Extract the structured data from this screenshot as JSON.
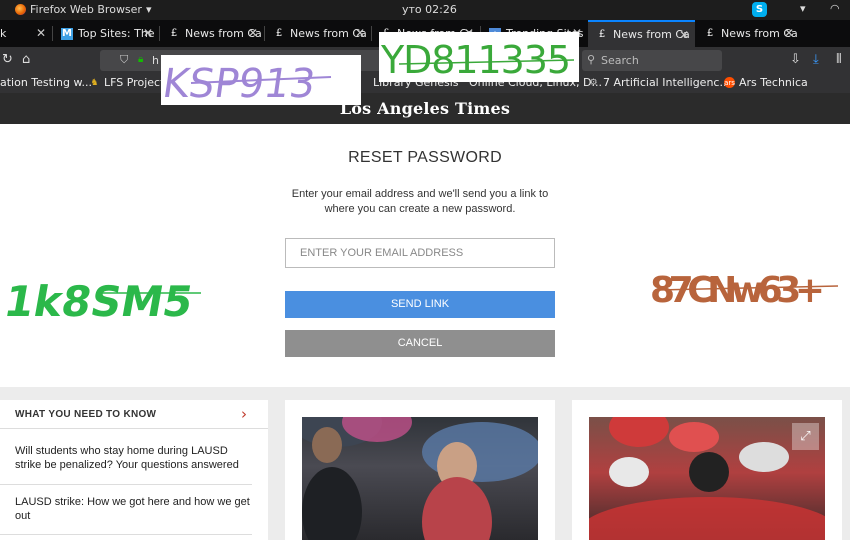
{
  "system": {
    "app_name": "Firefox Web Browser",
    "clock": "уто 02:26"
  },
  "tabs": [
    {
      "label": "k",
      "favicon": "partial-tab-icon"
    },
    {
      "label": "Top Sites: The",
      "favicon": "top-sites-icon"
    },
    {
      "label": "News from Ca",
      "favicon": "lat-icon"
    },
    {
      "label": "News from Ca",
      "favicon": "lat-icon"
    },
    {
      "label": "News from Ca",
      "favicon": "lat-icon"
    },
    {
      "label": "Trending Sites",
      "favicon": "trending-icon"
    },
    {
      "label": "News from Ca",
      "favicon": "lat-icon",
      "active": true
    },
    {
      "label": "News from Ca",
      "favicon": "lat-icon"
    }
  ],
  "navbar": {
    "url_fragment": "h",
    "search_placeholder": "Search"
  },
  "bookmarks": [
    {
      "label": "ation Testing w...",
      "icon": "bookmark-icon"
    },
    {
      "label": "LFS Project H",
      "icon": "lfs-icon"
    },
    {
      "label": "Library Genesis",
      "icon": "library-icon"
    },
    {
      "label": "Online Cloud, Linux, D...",
      "icon": "cloud-icon"
    },
    {
      "label": "7 Artificial Intelligenc...",
      "icon": "ai-icon"
    },
    {
      "label": "Ars Technica",
      "icon": "ars-icon"
    }
  ],
  "site": {
    "logo": "Los Angeles Times"
  },
  "reset": {
    "title": "RESET PASSWORD",
    "description": "Enter your email address and we'll send you a link to where you can create a new password.",
    "email_placeholder": "ENTER YOUR EMAIL ADDRESS",
    "send_label": "SEND LINK",
    "cancel_label": "CANCEL",
    "send_color": "#4a8fe0",
    "cancel_color": "#8f8f8f"
  },
  "know": {
    "title": "WHAT YOU NEED TO KNOW",
    "stories": [
      "Will students who stay home during LAUSD strike be penalized? Your questions answered",
      "LAUSD strike: How we got here and how we get out"
    ]
  },
  "captchas": [
    {
      "text": "KSP913",
      "color": "#9f86d6"
    },
    {
      "text": "YD811335",
      "color": "#3aa93a"
    },
    {
      "text": "1k8SM5",
      "color": "#2bb84a"
    },
    {
      "text": "87CNw63+",
      "color": "#b8643c"
    }
  ]
}
